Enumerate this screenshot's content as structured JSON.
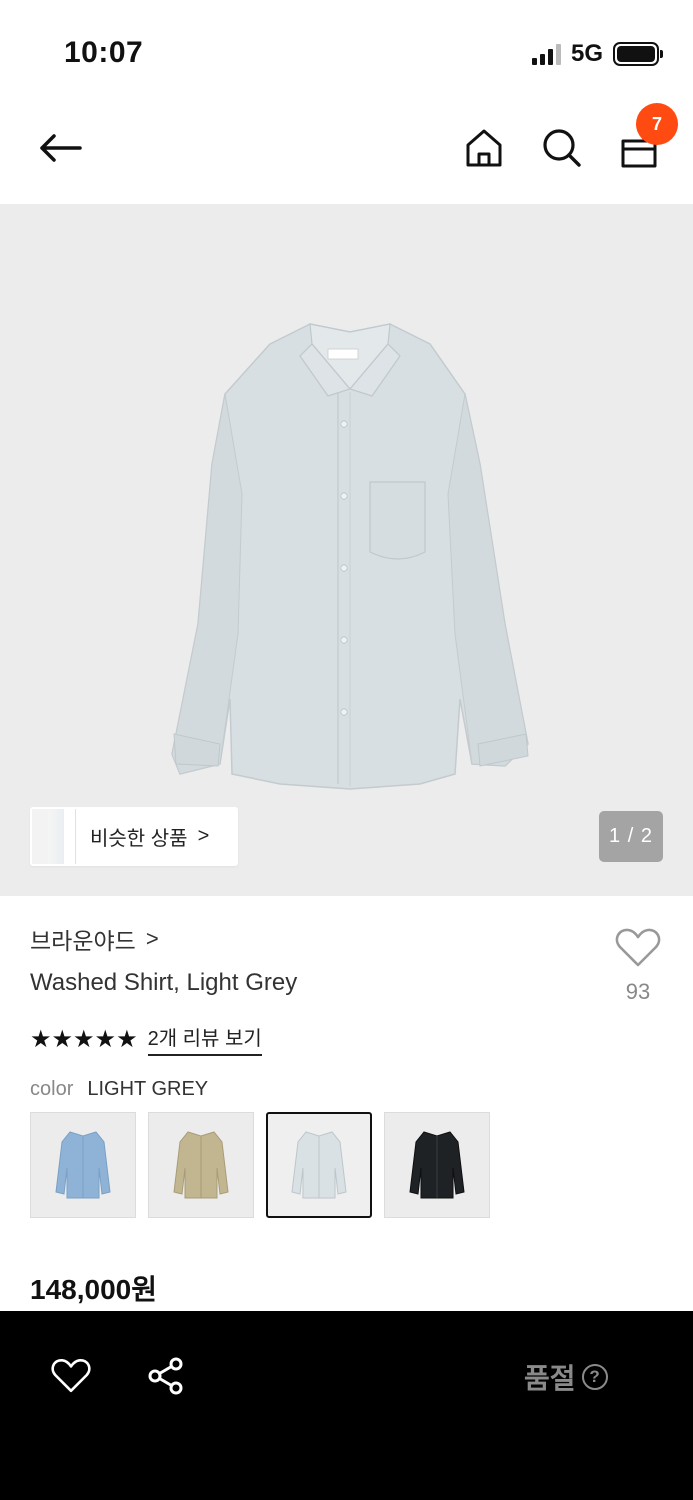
{
  "status_bar": {
    "time": "10:07",
    "network": "5G"
  },
  "nav": {
    "cart_count": "7",
    "icons": [
      "back-arrow-icon",
      "home-icon",
      "search-icon",
      "shopping-bag-icon"
    ]
  },
  "hero": {
    "similar_label": "비슷한 상품",
    "similar_chevron": ">",
    "page_indicator": "1 / 2"
  },
  "product": {
    "brand": "브라운야드",
    "brand_chevron": ">",
    "name": "Washed Shirt, Light Grey",
    "like_count": "93",
    "stars": "★★★★★",
    "rating": 5,
    "review_link": "2개 리뷰 보기",
    "color_label": "color",
    "color_value": "LIGHT GREY",
    "swatches": [
      {
        "name": "light-blue",
        "color": "#8fb3d6"
      },
      {
        "name": "beige",
        "color": "#c2b690"
      },
      {
        "name": "light-grey",
        "color": "#d9e1e4",
        "selected": true
      },
      {
        "name": "black",
        "color": "#1f2224"
      }
    ],
    "price": "148,000원"
  },
  "bottom_bar": {
    "soldout_label": "품절",
    "help_icon": "?"
  },
  "colors": {
    "badge": "#ff4b12",
    "hero_bg": "#ececec",
    "bottom_bar": "#000000",
    "soldout_text": "#8a8a8a"
  }
}
